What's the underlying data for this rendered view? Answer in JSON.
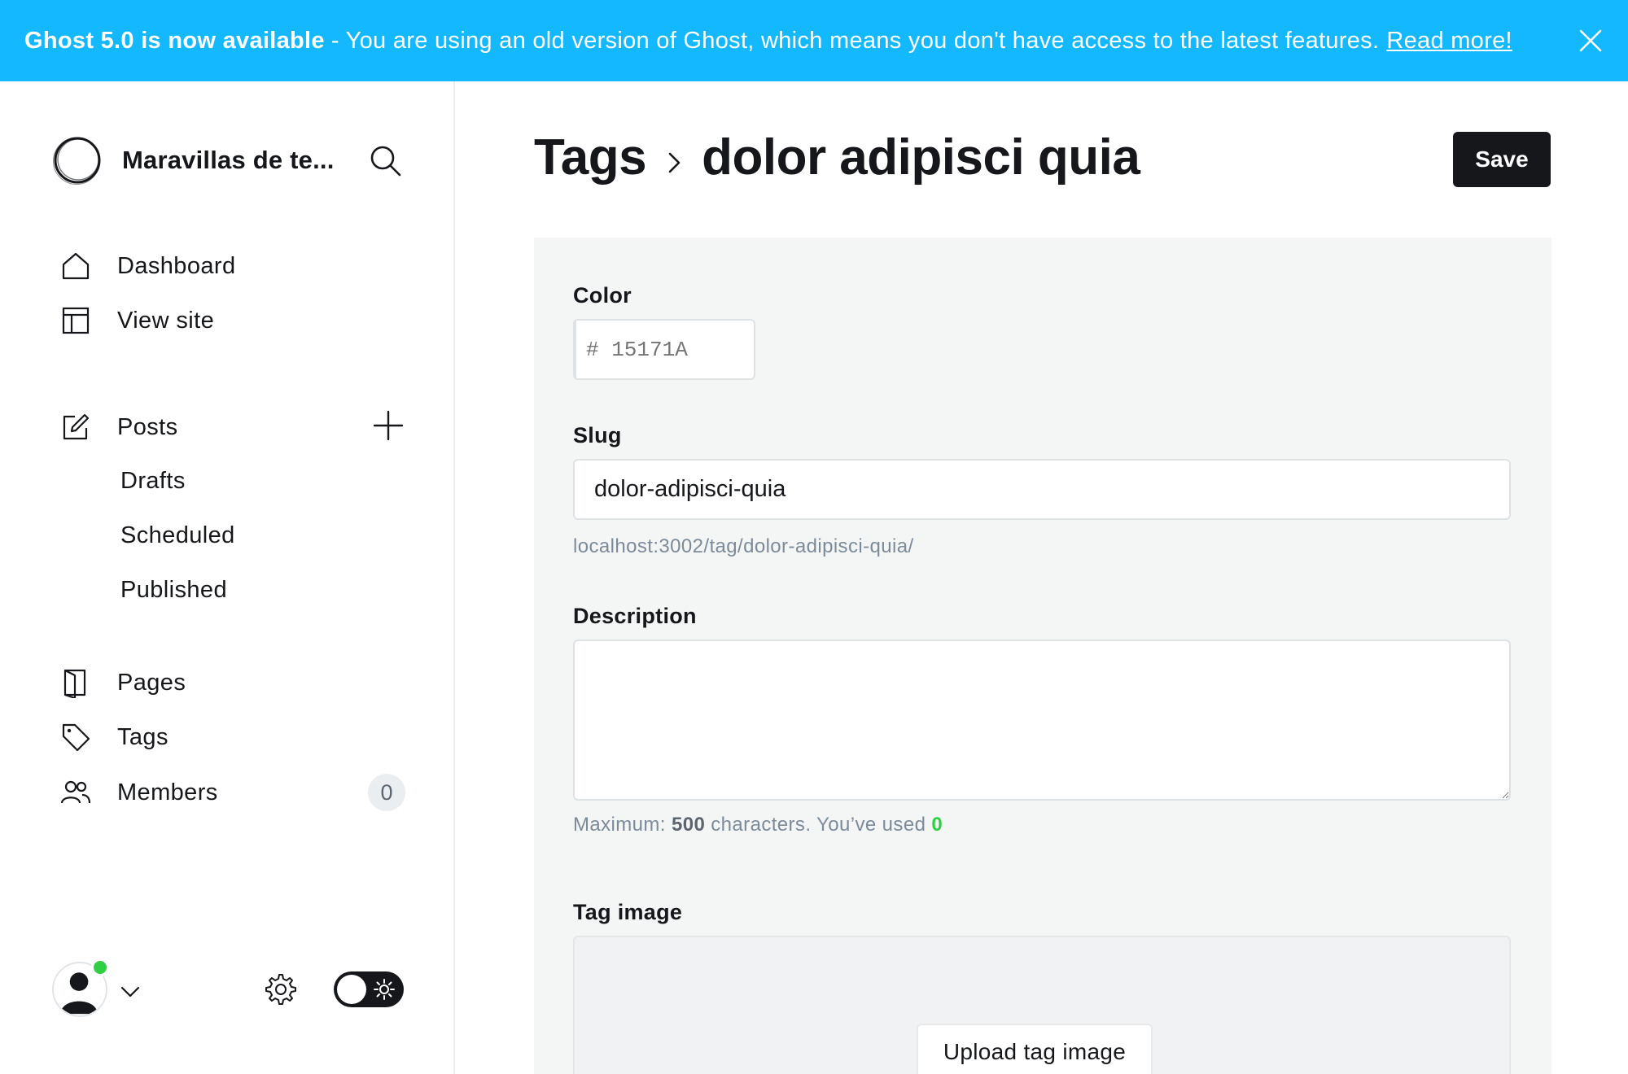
{
  "banner": {
    "headline": "Ghost 5.0 is now available",
    "message": "- You are using an old version of Ghost, which means you don't have access to the latest features.",
    "link": "Read more!"
  },
  "sidebar": {
    "site_name": "Maravillas de te...",
    "nav": {
      "dashboard": "Dashboard",
      "view_site": "View site",
      "posts": "Posts",
      "drafts": "Drafts",
      "scheduled": "Scheduled",
      "published": "Published",
      "pages": "Pages",
      "tags": "Tags",
      "members": "Members"
    },
    "members_count": "0"
  },
  "header": {
    "breadcrumb_parent": "Tags",
    "title": "dolor adipisci quia",
    "save_label": "Save"
  },
  "form": {
    "color_label": "Color",
    "color_value": "",
    "color_placeholder": "# 15171A",
    "slug_label": "Slug",
    "slug_value": "dolor-adipisci-quia",
    "slug_url": "localhost:3002/tag/dolor-adipisci-quia/",
    "description_label": "Description",
    "description_value": "",
    "desc_hint_prefix": "Maximum:",
    "desc_max": "500",
    "desc_hint_middle": "characters. You’ve used",
    "desc_used": "0",
    "tag_image_label": "Tag image",
    "upload_label": "Upload tag image"
  },
  "colors": {
    "banner": "#14b8ff",
    "primary_dark": "#15171a",
    "online": "#30cf43"
  }
}
